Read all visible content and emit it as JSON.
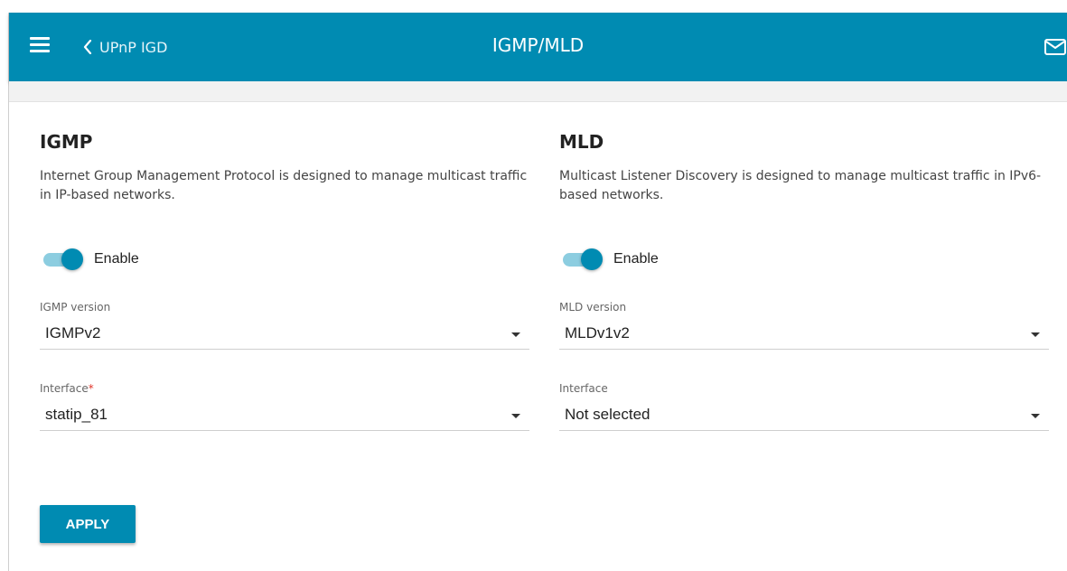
{
  "header": {
    "back_label": "UPnP IGD",
    "title": "IGMP/MLD"
  },
  "igmp": {
    "title": "IGMP",
    "description": "Internet Group Management Protocol is designed to manage multicast traffic in IP-based networks.",
    "enable_label": "Enable",
    "enabled": true,
    "version_label": "IGMP version",
    "version_value": "IGMPv2",
    "interface_label": "Interface",
    "interface_required_mark": "*",
    "interface_value": "statip_81"
  },
  "mld": {
    "title": "MLD",
    "description": "Multicast Listener Discovery is designed to manage multicast traffic in IPv6-based networks.",
    "enable_label": "Enable",
    "enabled": true,
    "version_label": "MLD version",
    "version_value": "MLDv1v2",
    "interface_label": "Interface",
    "interface_value": "Not selected"
  },
  "actions": {
    "apply_label": "APPLY"
  },
  "colors": {
    "accent": "#008bb2",
    "toggle_track": "#8ccde0",
    "required": "#e0352a"
  },
  "icons": {
    "menu": "hamburger-menu-icon",
    "back": "chevron-left-icon",
    "mail": "envelope-icon",
    "dropdown": "caret-down-icon"
  }
}
